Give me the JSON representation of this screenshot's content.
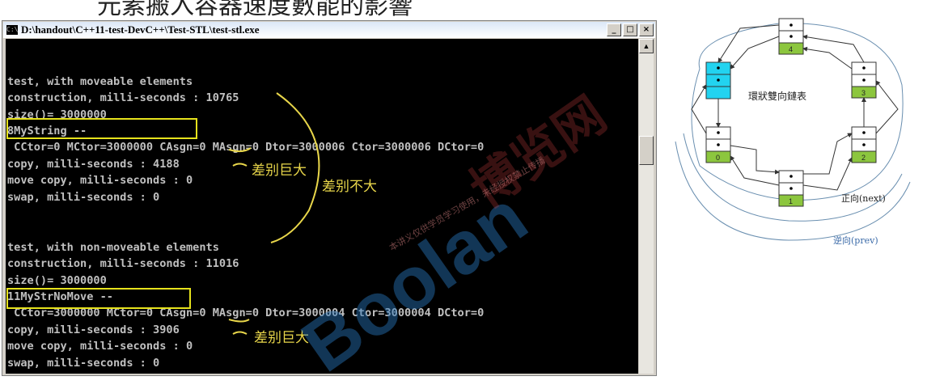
{
  "slide": {
    "title": "元素搬入容器速度數能的影響"
  },
  "window": {
    "title": "D:\\handout\\C++11-test-DevC++\\Test-STL\\test-stl.exe",
    "icon": "console-app-icon",
    "buttons": {
      "minimize": "_",
      "maximize": "□",
      "close": "×"
    }
  },
  "console": {
    "lines": [
      "",
      "test, with moveable elements",
      "construction, milli-seconds : 10765",
      "size()= 3000000",
      "8MyString --",
      " CCtor=0 MCtor=3000000 CAsgn=0 MAsgn=0 Dtor=3000006 Ctor=3000006 DCtor=0",
      "copy, milli-seconds : 4188",
      "move copy, milli-seconds : 0",
      "swap, milli-seconds : 0",
      "",
      "",
      "test, with non-moveable elements",
      "construction, milli-seconds : 11016",
      "size()= 3000000",
      "11MyStrNoMove --",
      " CCtor=3000000 MCtor=0 CAsgn=0 MAsgn=0 Dtor=3000004 Ctor=3000004 DCtor=0",
      "copy, milli-seconds : 3906",
      "move copy, milli-seconds : 0",
      "swap, milli-seconds : 0"
    ]
  },
  "annotations": {
    "big_diff_1": "差别巨大",
    "small_diff": "差别不大",
    "big_diff_2": "差别巨大",
    "color": "#e8d64a",
    "box_color": "#e6e21c"
  },
  "watermark": {
    "main": "Boolan",
    "cn": "博览网",
    "small": "本讲义仅供学员学习使用，未经授权禁止传播"
  },
  "diagram": {
    "center_label": "環狀雙向鏈表",
    "forward_label": "正向(next)",
    "backward_label": "逆向(prev)",
    "node_labels": [
      "0",
      "1",
      "2",
      "3",
      "4"
    ],
    "node_color": "#8cc63e",
    "head_color": "#22d3f0"
  }
}
